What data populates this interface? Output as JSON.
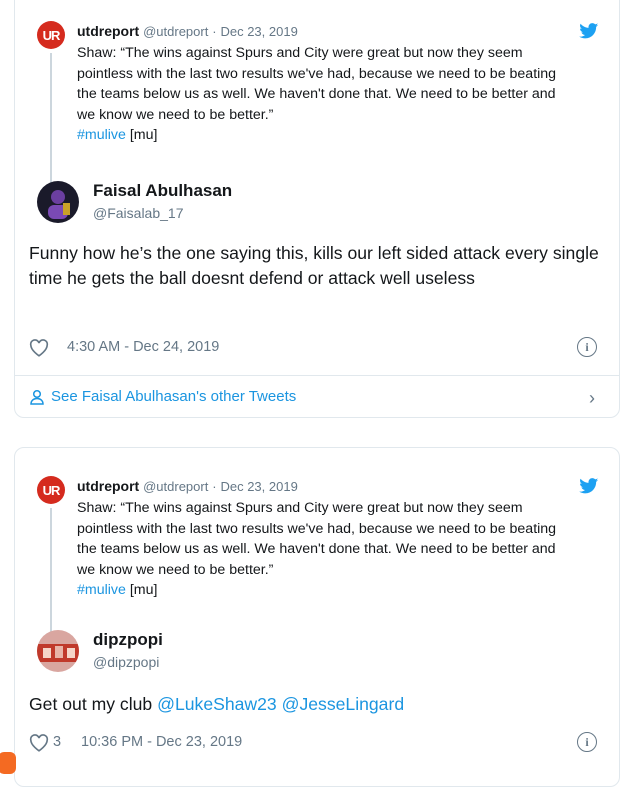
{
  "quoted_tweet": {
    "avatar_text": "UR",
    "name": "utdreport",
    "handle": "@utdreport",
    "separator": "·",
    "date": "Dec 23, 2019",
    "text": "Shaw: “The wins against Spurs and City were great but now they seem pointless with the last two results we've had, because we need to be beating the teams below us as well. We haven't done that. We need to be better and we know we need to be better.”",
    "hashtag": "#mulive",
    "tail": "[mu]",
    "colors": {
      "brand_red": "#d52b1e",
      "twitter_blue": "#1b95e0"
    }
  },
  "tweet1": {
    "name": "Faisal Abulhasan",
    "handle": "@Faisalab_17",
    "text": "Funny how he’s the one saying this, kills our left sided attack every single time he gets the ball doesnt defend or attack well useless",
    "timestamp": "4:30 AM - Dec 24, 2019",
    "like_count": "",
    "see_more": "See Faisal Abulhasan's other Tweets",
    "icons": [
      "heart-icon",
      "info-icon",
      "person-icon",
      "chevron-right-icon"
    ]
  },
  "tweet2": {
    "name": "dipzpopi",
    "handle": "@dipzpopi",
    "text_prefix": "Get out my club ",
    "mention1": "@LukeShaw23",
    "mention_sep": " ",
    "mention2": "@JesseLingard",
    "like_count": "3",
    "timestamp": "10:36 PM - Dec 23, 2019",
    "icons": [
      "heart-icon",
      "info-icon"
    ]
  }
}
